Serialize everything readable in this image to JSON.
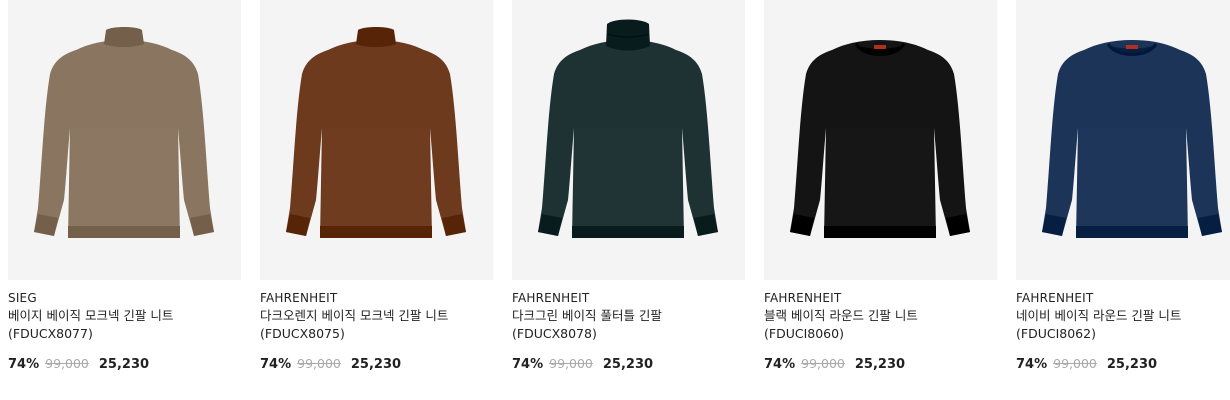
{
  "products": [
    {
      "brand": "SIEG",
      "name": "베이지 베이직 모크넥 긴팔 니트 (FDUCX8077)",
      "discount": "74%",
      "original_price": "99,000",
      "sale_price": "25,230",
      "color": "#8a7660",
      "collar": "mock",
      "label": false
    },
    {
      "brand": "FAHRENHEIT",
      "name": "다크오렌지 베이직 모크넥 긴팔 니트 (FDUCX8075)",
      "discount": "74%",
      "original_price": "99,000",
      "sale_price": "25,230",
      "color": "#6e3a1d",
      "collar": "mock",
      "label": false
    },
    {
      "brand": "FAHRENHEIT",
      "name": "다크그린 베이직 풀터틀 긴팔 (FDUCX8078)",
      "discount": "74%",
      "original_price": "99,000",
      "sale_price": "25,230",
      "color": "#1e3133",
      "collar": "turtle",
      "label": false
    },
    {
      "brand": "FAHRENHEIT",
      "name": "블랙 베이직 라운드 긴팔 니트 (FDUCI8060)",
      "discount": "74%",
      "original_price": "99,000",
      "sale_price": "25,230",
      "color": "#141414",
      "collar": "round",
      "label": true
    },
    {
      "brand": "FAHRENHEIT",
      "name": "네이비 베이직 라운드 긴팔 니트 (FDUCI8062)",
      "discount": "74%",
      "original_price": "99,000",
      "sale_price": "25,230",
      "color": "#1c3458",
      "collar": "round",
      "label": true
    }
  ]
}
